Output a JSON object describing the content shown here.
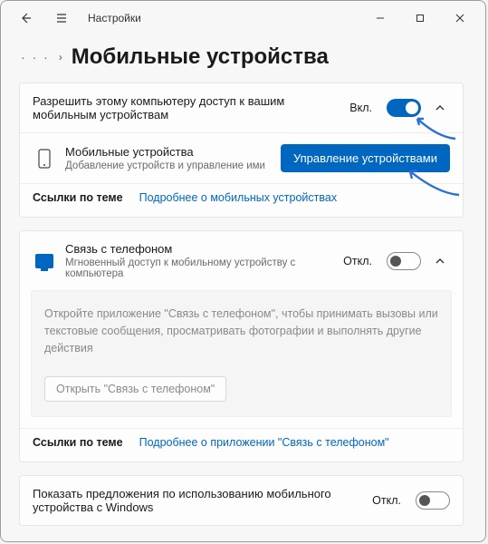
{
  "window": {
    "title": "Настройки"
  },
  "breadcrumb": {
    "dots": "· · ·",
    "chevron": "›"
  },
  "page": {
    "title": "Мобильные устройства"
  },
  "section1": {
    "allow": {
      "title": "Разрешить этому компьютеру доступ к вашим мобильным устройствам",
      "state_label": "Вкл."
    },
    "devices": {
      "title": "Мобильные устройства",
      "subtitle": "Добавление устройств и управление ими",
      "button": "Управление устройствами"
    },
    "links": {
      "header": "Ссылки по теме",
      "link": "Подробнее о мобильных устройствах"
    }
  },
  "section2": {
    "phonelink": {
      "title": "Связь с телефоном",
      "subtitle": "Мгновенный доступ к мобильному устройству с компьютера",
      "state_label": "Откл."
    },
    "hint": {
      "text": "Откройте приложение \"Связь с телефоном\", чтобы принимать вызовы или текстовые сообщения, просматривать фотографии и выполнять другие действия",
      "button": "Открыть \"Связь с телефоном\""
    },
    "links": {
      "header": "Ссылки по теме",
      "link": "Подробнее о приложении \"Связь с телефоном\""
    }
  },
  "section3": {
    "suggestions": {
      "title": "Показать предложения по использованию мобильного устройства с Windows",
      "state_label": "Откл."
    }
  }
}
